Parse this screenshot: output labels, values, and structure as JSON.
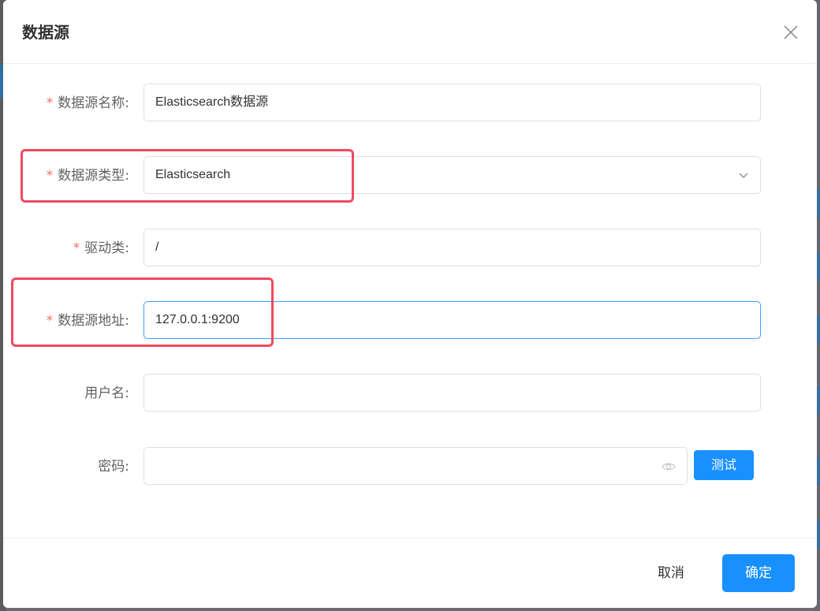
{
  "dialog": {
    "title": "数据源",
    "close_icon": "close-icon"
  },
  "form": {
    "name": {
      "required": "*",
      "label": "数据源名称:",
      "value": "Elasticsearch数据源"
    },
    "type": {
      "required": "*",
      "label": "数据源类型:",
      "value": "Elasticsearch",
      "icon": "chevron-down-icon"
    },
    "driver": {
      "required": "*",
      "label": "驱动类:",
      "value": "/"
    },
    "address": {
      "required": "*",
      "label": "数据源地址:",
      "value": "127.0.0.1:9200"
    },
    "username": {
      "label": "用户名:",
      "value": ""
    },
    "password": {
      "label": "密码:",
      "value": "",
      "icon": "eye-icon",
      "test_label": "测试"
    }
  },
  "footer": {
    "cancel_label": "取消",
    "confirm_label": "确定"
  },
  "colors": {
    "primary": "#1890ff",
    "required": "#f56c6c",
    "highlight": "#f04a5f",
    "focus_border": "#409eff"
  }
}
